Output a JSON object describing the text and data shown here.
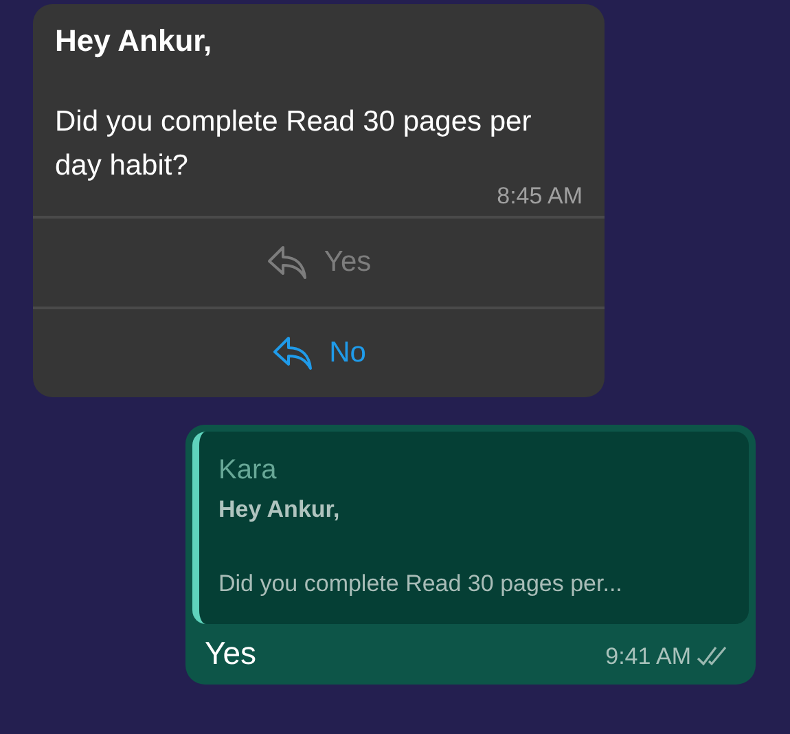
{
  "messages": [
    {
      "kind": "incoming",
      "header": "Hey Ankur,",
      "body": "Did you complete Read 30 pages per day habit?",
      "time": "8:45 AM",
      "replies": [
        {
          "label": "Yes",
          "disabled": true
        },
        {
          "label": "No",
          "disabled": false
        }
      ]
    },
    {
      "kind": "outgoing",
      "quote": {
        "author": "Kara",
        "header": "Hey Ankur,",
        "body": "Did you complete Read 30 pages per..."
      },
      "text": "Yes",
      "time": "9:41 AM",
      "read": false
    }
  ]
}
